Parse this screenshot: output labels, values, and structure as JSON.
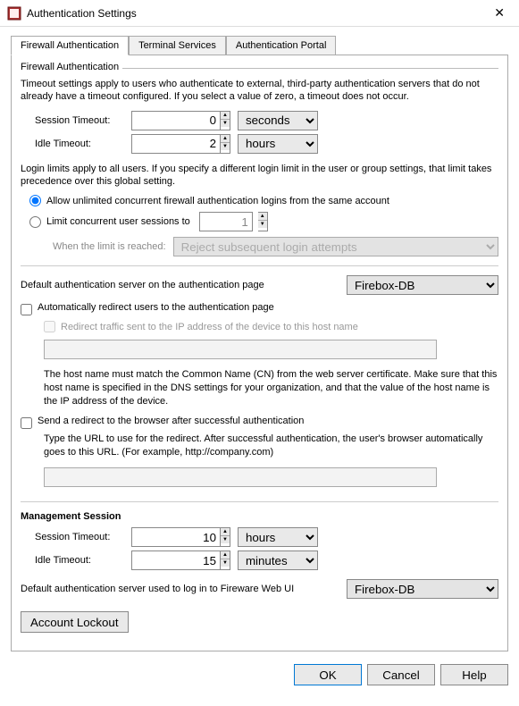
{
  "window": {
    "title": "Authentication Settings"
  },
  "tabs": {
    "firewall": "Firewall Authentication",
    "terminal": "Terminal Services",
    "portal": "Authentication Portal"
  },
  "fw": {
    "legend": "Firewall Authentication",
    "timeout_desc": "Timeout settings apply to users who authenticate to external, third-party authentication servers that do not already have a timeout configured. If you select a value of zero, a timeout does not occur.",
    "session_label": "Session Timeout:",
    "session_value": "0",
    "session_unit": "seconds",
    "idle_label": "Idle Timeout:",
    "idle_value": "2",
    "idle_unit": "hours",
    "login_desc": "Login limits apply to all users. If you specify a different login limit in the user or group settings, that limit takes precedence over this global setting.",
    "radio_unlimited": "Allow unlimited concurrent firewall authentication logins from the same account",
    "radio_limit": "Limit concurrent user sessions to",
    "limit_value": "1",
    "reached_label": "When the limit is reached:",
    "reached_option": "Reject subsequent login attempts",
    "def_auth_label": "Default authentication server on the authentication page",
    "def_auth_option": "Firebox-DB",
    "auto_redirect": "Automatically redirect users to the authentication page",
    "redirect_sub": "Redirect traffic sent to the IP address of the device to this host name",
    "host_help": "The host name must match the Common Name (CN) from the web server certificate. Make sure that this host name is specified in the DNS settings for your organization, and that the value of the host name is the IP address of the device.",
    "send_redirect": "Send a redirect to the browser after successful authentication",
    "send_help": "Type the URL to use for the redirect. After successful authentication, the user's browser automatically goes to this URL. (For example, http://company.com)"
  },
  "mgmt": {
    "legend": "Management Session",
    "session_label": "Session Timeout:",
    "session_value": "10",
    "session_unit": "hours",
    "idle_label": "Idle Timeout:",
    "idle_value": "15",
    "idle_unit": "minutes",
    "webui_label": "Default authentication server used to log in to Fireware Web UI",
    "webui_option": "Firebox-DB"
  },
  "account_lockout": "Account Lockout",
  "buttons": {
    "ok": "OK",
    "cancel": "Cancel",
    "help": "Help"
  }
}
